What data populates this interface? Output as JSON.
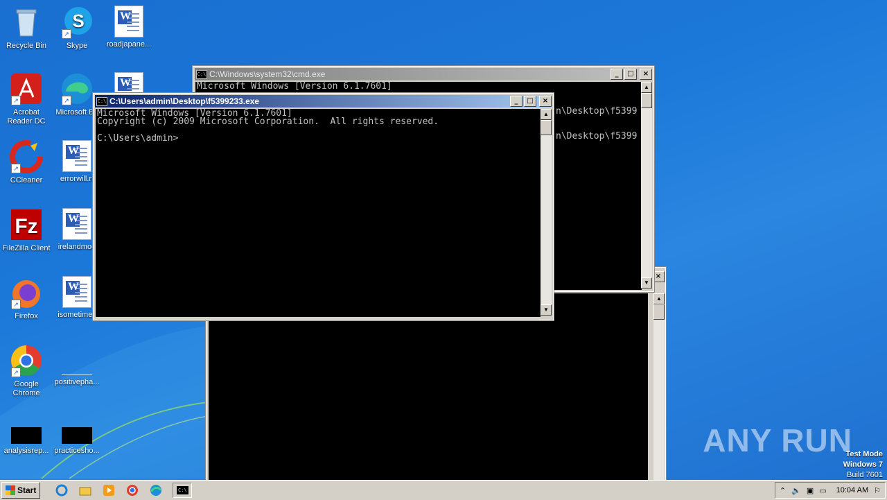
{
  "desktop_icons": [
    {
      "label": "Recycle Bin",
      "icon": "recycle-bin-icon"
    },
    {
      "label": "Skype",
      "icon": "skype-icon"
    },
    {
      "label": "roadjapane...",
      "icon": "word-document-icon"
    },
    {
      "label": "Acrobat Reader DC",
      "icon": "acrobat-icon"
    },
    {
      "label": "Microsoft Ed",
      "icon": "edge-icon"
    },
    {
      "label": "CCleaner",
      "icon": "ccleaner-icon"
    },
    {
      "label": "errorwill.rt",
      "icon": "word-document-icon"
    },
    {
      "label": "FileZilla Client",
      "icon": "filezilla-icon"
    },
    {
      "label": "irelandmod",
      "icon": "word-document-icon"
    },
    {
      "label": "Firefox",
      "icon": "firefox-icon"
    },
    {
      "label": "isometimes",
      "icon": "word-document-icon"
    },
    {
      "label": "Google Chrome",
      "icon": "chrome-icon"
    },
    {
      "label": "positivepha...",
      "icon": "blank-file-icon"
    },
    {
      "label": "analysisrep...",
      "icon": "black-file-icon"
    },
    {
      "label": "practicesho...",
      "icon": "black-file-icon"
    }
  ],
  "windows": {
    "back_cmd": {
      "title": "C:\\Windows\\system32\\cmd.exe",
      "lines": [
        "Microsoft Windows [Version 6.1.7601]",
        "",
        "",
        "n\\Desktop\\f5399",
        "",
        "",
        "n\\Desktop\\f5399"
      ]
    },
    "front_cmd": {
      "title": "C:\\Users\\admin\\Desktop\\f5399233.exe",
      "lines": [
        "Microsoft Windows [Version 6.1.7601]",
        "Copyright (c) 2009 Microsoft Corporation.  All rights reserved.",
        "",
        "C:\\Users\\admin>"
      ]
    },
    "buttons": {
      "minimize": "_",
      "maximize": "□",
      "close": "×"
    }
  },
  "taskbar": {
    "start_label": "Start",
    "pinned": [
      "ie-icon",
      "explorer-icon",
      "media-player-icon",
      "chrome-icon",
      "edge-icon",
      "cmd-icon"
    ],
    "clock": "10:04 AM"
  },
  "watermark": {
    "brand": "ANY RUN",
    "line1": "Test Mode",
    "line2": "Windows 7",
    "line3": "Build 7601"
  }
}
